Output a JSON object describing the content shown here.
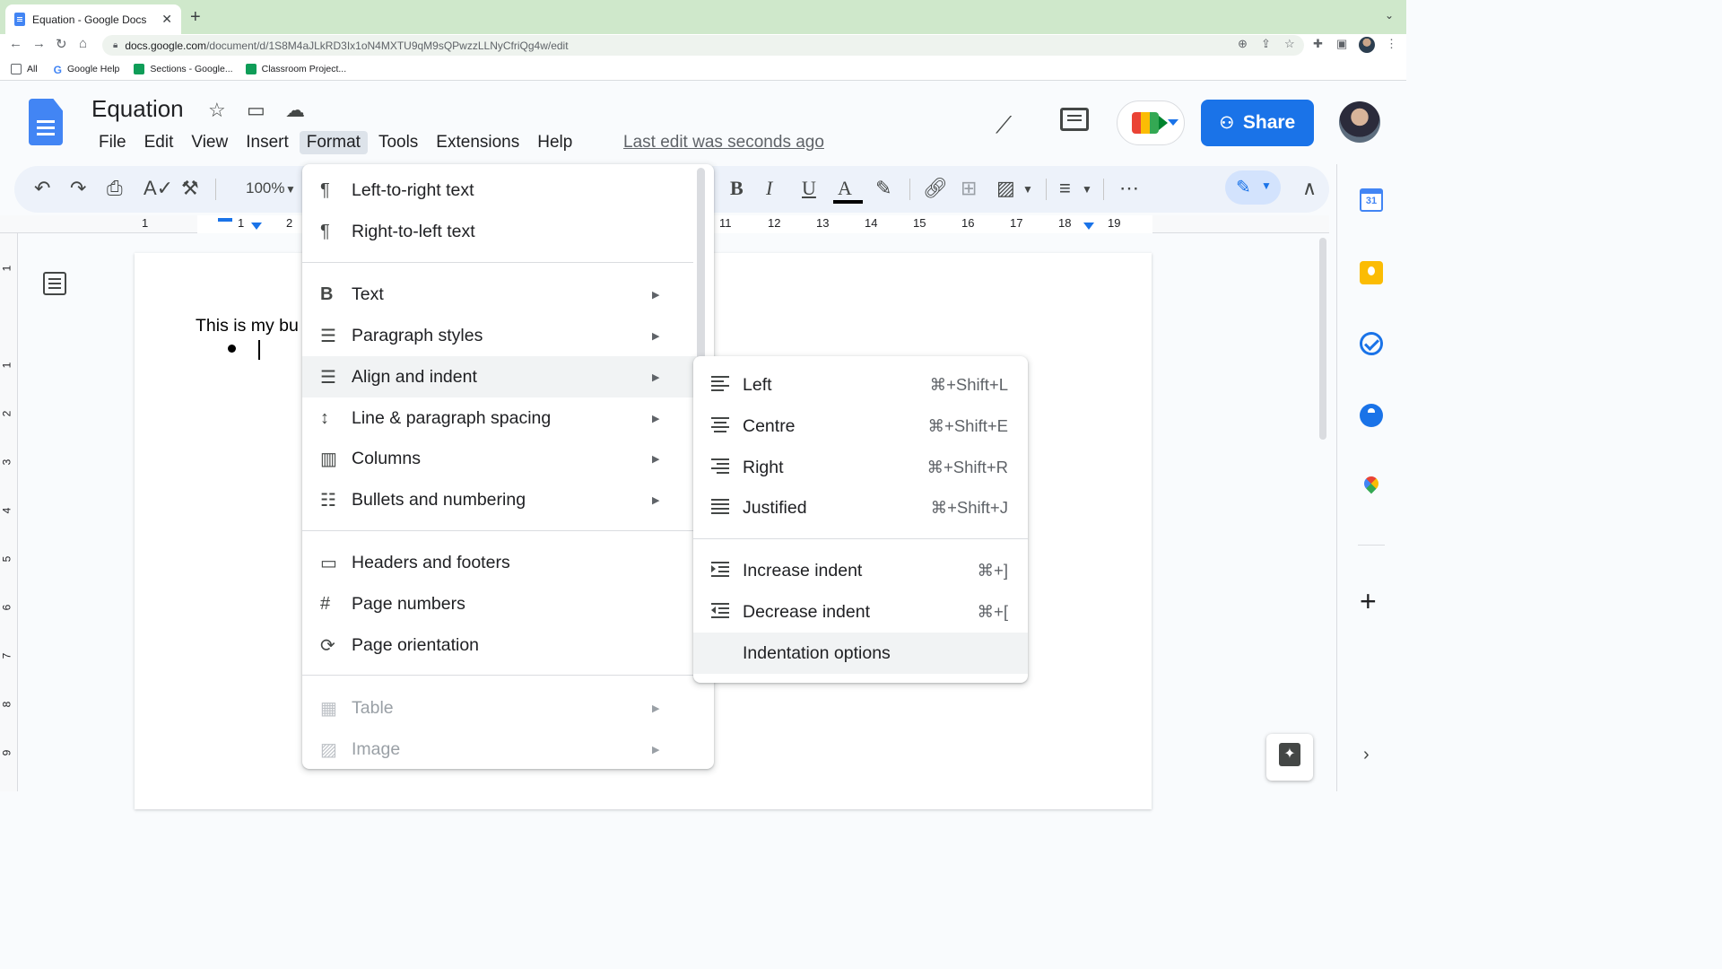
{
  "browser": {
    "tab_title": "Equation - Google Docs",
    "tab_close": "✕",
    "new_tab": "+",
    "url_host": "docs.google.com",
    "url_path": "/document/d/1S8M4aJLkRD3Ix1oN4MXTU9qM9sQPwzzLLNyCfriQg4w/edit",
    "bookmarks": [
      "All",
      "Google Help",
      "Sections - Google...",
      "Classroom Project..."
    ]
  },
  "docs": {
    "title": "Equation",
    "menus": [
      "File",
      "Edit",
      "View",
      "Insert",
      "Format",
      "Tools",
      "Extensions",
      "Help"
    ],
    "active_menu": "Format",
    "last_edit": "Last edit was seconds ago",
    "share_label": "Share",
    "zoom": "100%"
  },
  "ruler": {
    "numbers": [
      "1",
      "1",
      "2",
      "11",
      "12",
      "13",
      "14",
      "15",
      "16",
      "17",
      "18",
      "19"
    ],
    "vertical": [
      "1",
      "1",
      "2",
      "3",
      "4",
      "5",
      "6",
      "7",
      "8",
      "9"
    ]
  },
  "document": {
    "text": "This is my bu"
  },
  "format_menu": {
    "items": [
      {
        "label": "Left-to-right text",
        "icon": "ltr-icon",
        "submenu": false
      },
      {
        "label": "Right-to-left text",
        "icon": "rtl-icon",
        "submenu": false
      },
      {
        "label": "Text",
        "icon": "bold-icon",
        "submenu": true
      },
      {
        "label": "Paragraph styles",
        "icon": "paragraph-styles-icon",
        "submenu": true
      },
      {
        "label": "Align and indent",
        "icon": "align-indent-icon",
        "submenu": true
      },
      {
        "label": "Line & paragraph spacing",
        "icon": "line-spacing-icon",
        "submenu": true
      },
      {
        "label": "Columns",
        "icon": "columns-icon",
        "submenu": true
      },
      {
        "label": "Bullets and numbering",
        "icon": "bullets-icon",
        "submenu": true
      },
      {
        "label": "Headers and footers",
        "icon": "headers-footers-icon",
        "submenu": false
      },
      {
        "label": "Page numbers",
        "icon": "hash-icon",
        "submenu": false
      },
      {
        "label": "Page orientation",
        "icon": "page-orientation-icon",
        "submenu": false
      },
      {
        "label": "Table",
        "icon": "table-icon",
        "submenu": true
      },
      {
        "label": "Image",
        "icon": "image-icon",
        "submenu": true
      }
    ]
  },
  "align_menu": {
    "items": [
      {
        "label": "Left",
        "shortcut": "⌘+Shift+L"
      },
      {
        "label": "Centre",
        "shortcut": "⌘+Shift+E"
      },
      {
        "label": "Right",
        "shortcut": "⌘+Shift+R"
      },
      {
        "label": "Justified",
        "shortcut": "⌘+Shift+J"
      },
      {
        "label": "Increase indent",
        "shortcut": "⌘+]"
      },
      {
        "label": "Decrease indent",
        "shortcut": "⌘+["
      },
      {
        "label": "Indentation options",
        "shortcut": ""
      }
    ]
  },
  "side_panel": {
    "calendar_day": "31"
  },
  "colors": {
    "accent": "#1a73e8",
    "tabstrip": "#cfe8cb",
    "hover": "#f1f3f4"
  }
}
